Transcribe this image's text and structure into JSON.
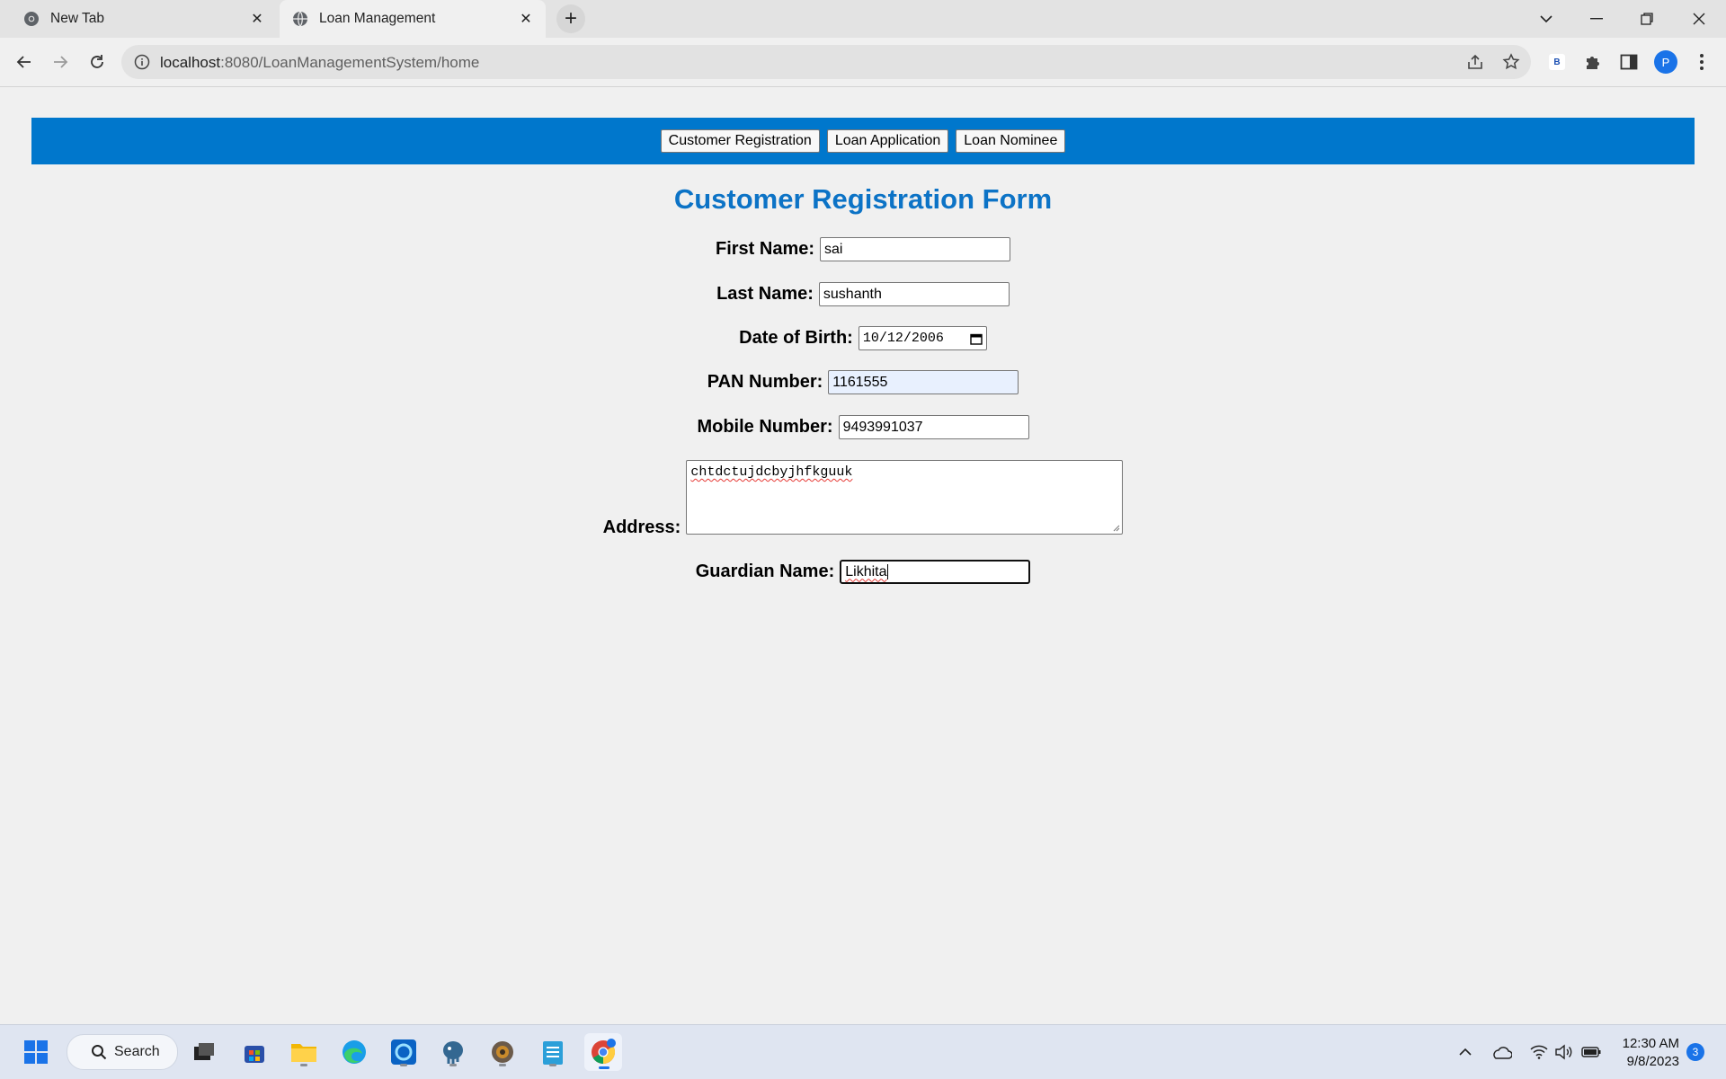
{
  "browser": {
    "tabs": [
      {
        "label": "New Tab",
        "icon": "chrome-icon"
      },
      {
        "label": "Loan Management",
        "icon": "globe-icon",
        "active": true
      }
    ],
    "url_host": "localhost",
    "url_path": ":8080/LoanManagementSystem/home",
    "profile_initial": "P",
    "extension_badge": "B"
  },
  "nav": {
    "buttons": [
      "Customer Registration",
      "Loan Application",
      "Loan Nominee"
    ],
    "bar_color": "#0077cc"
  },
  "form": {
    "title": "Customer Registration Form",
    "title_color": "#0c73c6",
    "first_name": {
      "label": "First Name:",
      "value": "sai"
    },
    "last_name": {
      "label": "Last Name:",
      "value": "sushanth"
    },
    "dob": {
      "label": "Date of Birth:",
      "value": "10/12/2006"
    },
    "pan": {
      "label": "PAN Number:",
      "value": "1161555"
    },
    "mobile": {
      "label": "Mobile Number:",
      "value": "9493991037"
    },
    "address": {
      "label": "Address:",
      "value": "chtdctujdcbyjhfkguuk"
    },
    "guardian": {
      "label": "Guardian Name:",
      "value": "Likhita"
    }
  },
  "taskbar": {
    "search_label": "Search",
    "time": "12:30 AM",
    "date": "9/8/2023",
    "notifications": "3"
  }
}
